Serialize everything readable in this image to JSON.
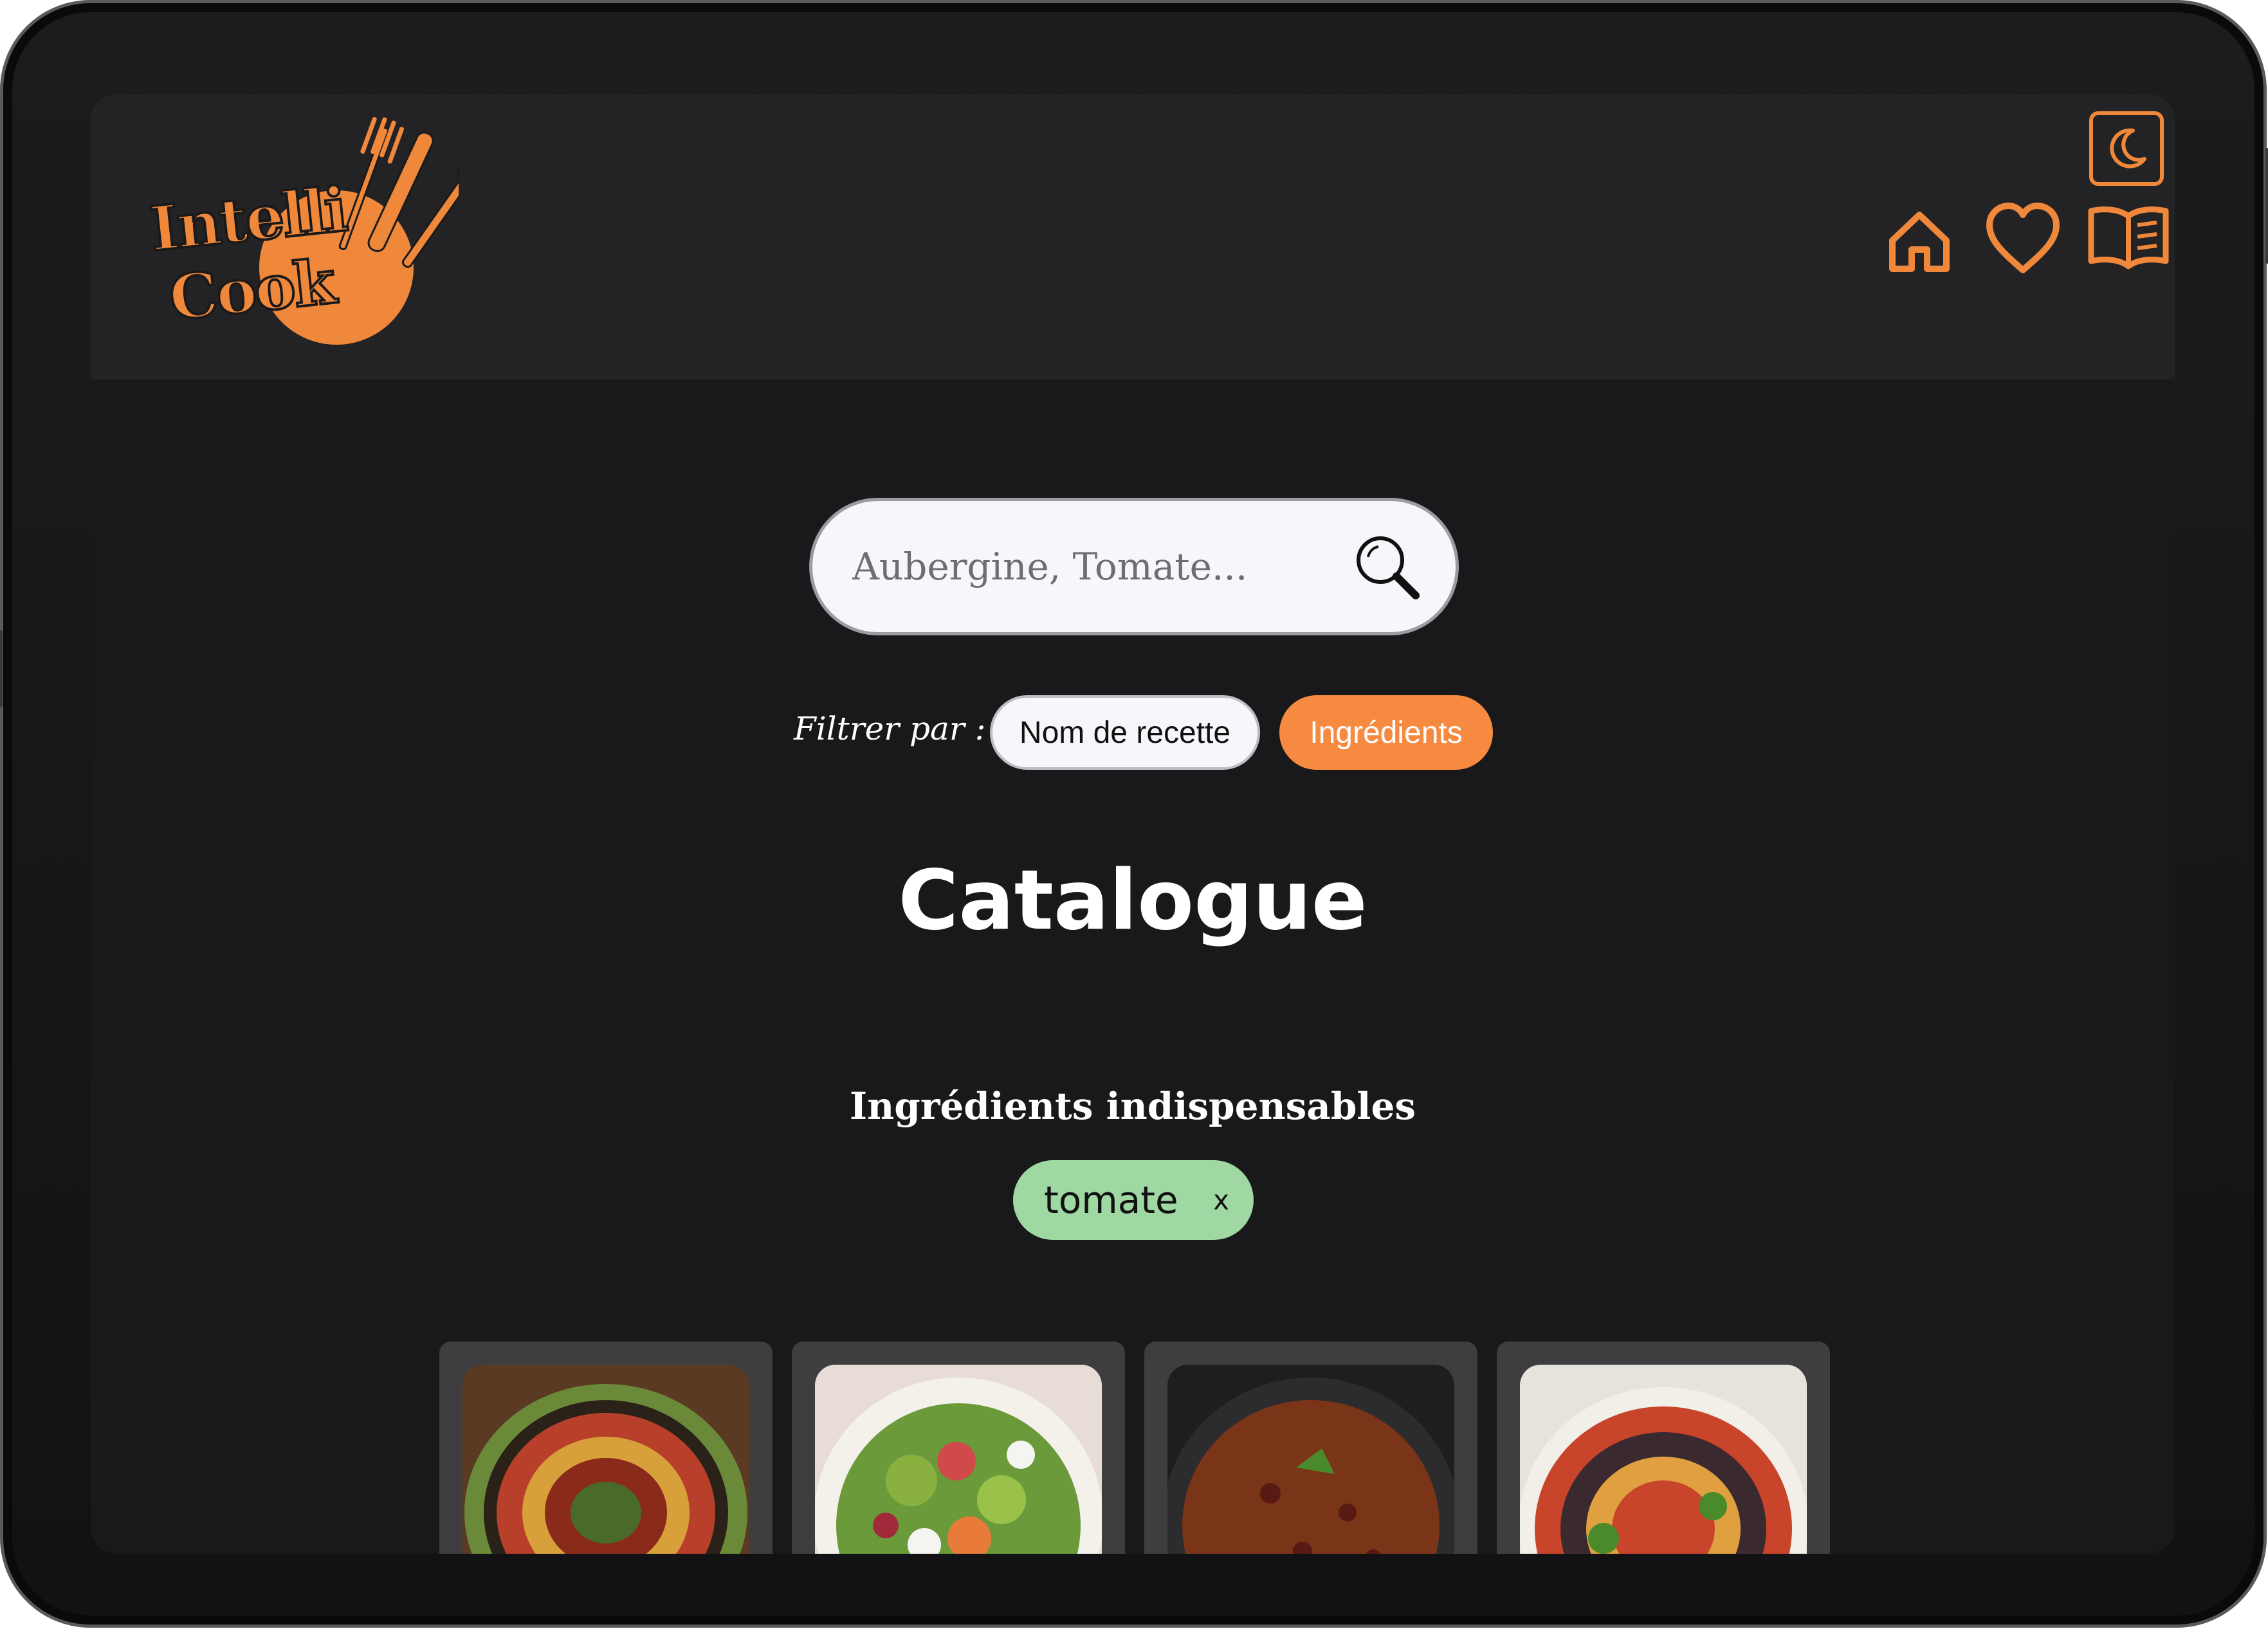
{
  "app": {
    "logo_line1": "Intelli",
    "logo_line2": "Cook"
  },
  "nav": {
    "icons": [
      "home-icon",
      "heart-icon",
      "book-icon"
    ],
    "theme_icon": "moon-icon"
  },
  "search": {
    "placeholder": "Aubergine, Tomate...",
    "value": ""
  },
  "filter": {
    "label": "Filtrer par :",
    "options": [
      "Nom de recette",
      "Ingrédients"
    ],
    "selected": "Ingrédients"
  },
  "catalogue": {
    "title": "Catalogue"
  },
  "ingredients": {
    "heading": "Ingrédients indispensables",
    "tags": [
      {
        "label": "tomate",
        "remove": "x"
      }
    ]
  },
  "colors": {
    "accent": "#f58a40",
    "tag": "#9fd8a2",
    "background": "#19191b",
    "header": "#232325"
  }
}
